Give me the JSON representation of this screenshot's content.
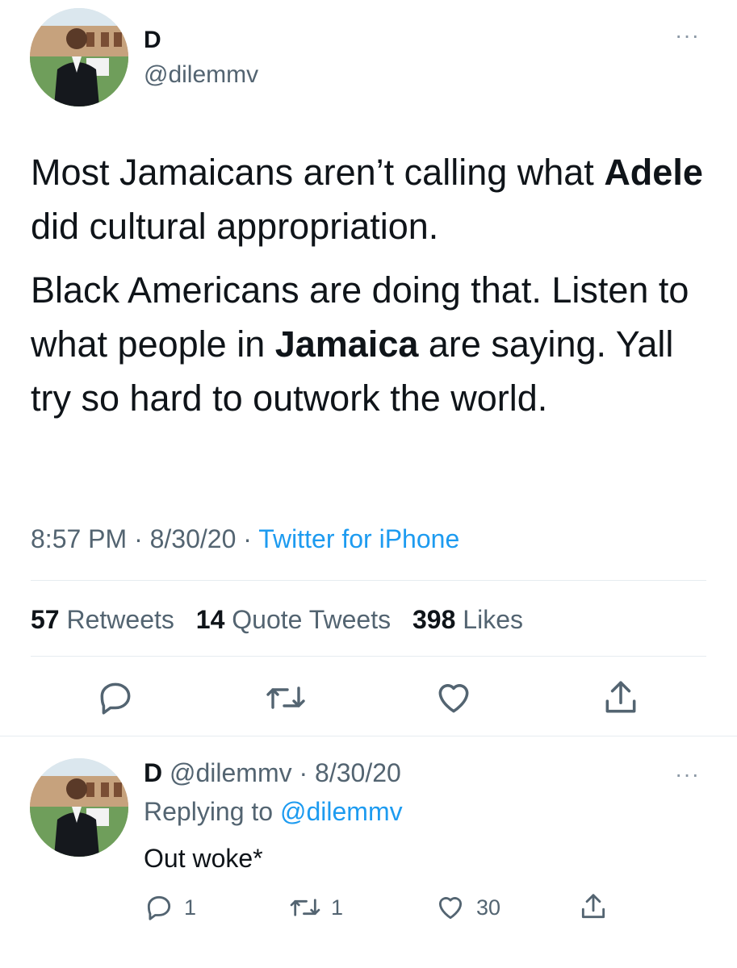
{
  "tweet": {
    "author": {
      "name": "D",
      "handle": "@dilemmv"
    },
    "more_label": "···",
    "text": {
      "p1_before": "Most Jamaicans aren’t calling what ",
      "p1_bold": "Adele",
      "p1_after": " did cultural appropriation.",
      "p2_before": "Black Americans are doing that. Listen to what people in ",
      "p2_bold": "Jamaica",
      "p2_after": " are saying. Yall try so hard to outwork the world."
    },
    "meta": {
      "time": "8:57 PM",
      "sep1": " · ",
      "date": "8/30/20",
      "sep2": " · ",
      "source": "Twitter for iPhone"
    },
    "stats": {
      "retweets_count": "57",
      "retweets_label": "Retweets",
      "quotes_count": "14",
      "quotes_label": "Quote Tweets",
      "likes_count": "398",
      "likes_label": "Likes"
    },
    "actions": [
      "reply-icon",
      "retweet-icon",
      "like-icon",
      "share-icon"
    ]
  },
  "reply": {
    "author": {
      "name": "D",
      "handle": "@dilemmv"
    },
    "sep": " · ",
    "date": "8/30/20",
    "replying_prefix": "Replying to ",
    "replying_handle": "@dilemmv",
    "more_label": "···",
    "text": "Out woke*",
    "counts": {
      "replies": "1",
      "retweets": "1",
      "likes": "30"
    }
  },
  "colors": {
    "accent": "#1d9bf0",
    "text": "#0f1419",
    "muted": "#536471",
    "divider": "#e6ecf0"
  }
}
